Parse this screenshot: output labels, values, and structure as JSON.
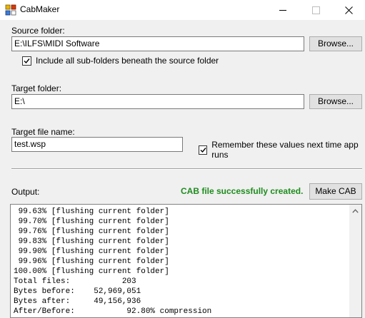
{
  "window": {
    "title": "CabMaker"
  },
  "source": {
    "label": "Source folder:",
    "value": "E:\\ILFS\\MIDI Software",
    "browse_label": "Browse...",
    "include_subfolders_label": "Include all sub-folders beneath the source folder",
    "include_subfolders_checked": true
  },
  "target": {
    "label": "Target folder:",
    "value": "E:\\",
    "browse_label": "Browse..."
  },
  "filename": {
    "label": "Target file name:",
    "value": "test.wsp",
    "remember_label": "Remember these values next time app runs",
    "remember_checked": true
  },
  "output": {
    "label": "Output:",
    "status_text": "CAB file successfully created.",
    "status_color": "#1e8c1e",
    "make_button_label": "Make CAB",
    "lines": [
      " 99.63% [flushing current folder]",
      " 99.70% [flushing current folder]",
      " 99.76% [flushing current folder]",
      " 99.83% [flushing current folder]",
      " 99.90% [flushing current folder]",
      " 99.96% [flushing current folder]",
      "100.00% [flushing current folder]",
      "Total files:           203",
      "Bytes before:    52,969,051",
      "Bytes after:     49,156,936",
      "After/Before:           92.80% compression"
    ]
  }
}
